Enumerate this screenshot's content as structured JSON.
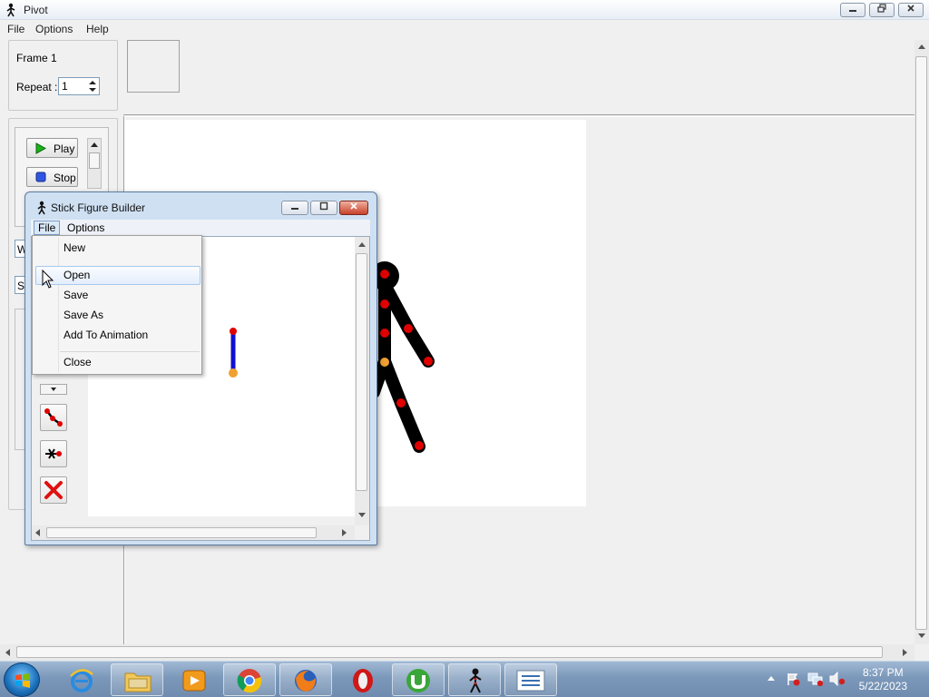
{
  "main_window": {
    "title": "Pivot",
    "menu": [
      "File",
      "Options",
      "Help"
    ],
    "frame_label": "Frame 1",
    "repeat_label": "Repeat :",
    "repeat_value": "1",
    "play_label": "Play",
    "stop_label": "Stop",
    "partial_labels": [
      "W",
      "S"
    ]
  },
  "dialog": {
    "title": "Stick Figure Builder",
    "menu": [
      "File",
      "Options"
    ],
    "file_menu": {
      "items": [
        "New",
        "Open",
        "Save",
        "Save As",
        "Add To Animation",
        "Close"
      ],
      "highlighted": "Open"
    }
  },
  "taskbar": {
    "apps": [
      "Internet Explorer",
      "Windows Explorer",
      "Windows Media Player",
      "Google Chrome",
      "Mozilla Firefox",
      "Opera",
      "uTorrent",
      "Pivot",
      "Stick Figure Builder"
    ],
    "time": "8:37 PM",
    "date": "5/22/2023"
  },
  "colors": {
    "stick_figure": "#000000",
    "joint_red": "#e00000",
    "joint_orange": "#f0a030",
    "segment_blue": "#1010d0",
    "titlebar": "#dce7f4",
    "taskbar": "#7b98ba"
  }
}
